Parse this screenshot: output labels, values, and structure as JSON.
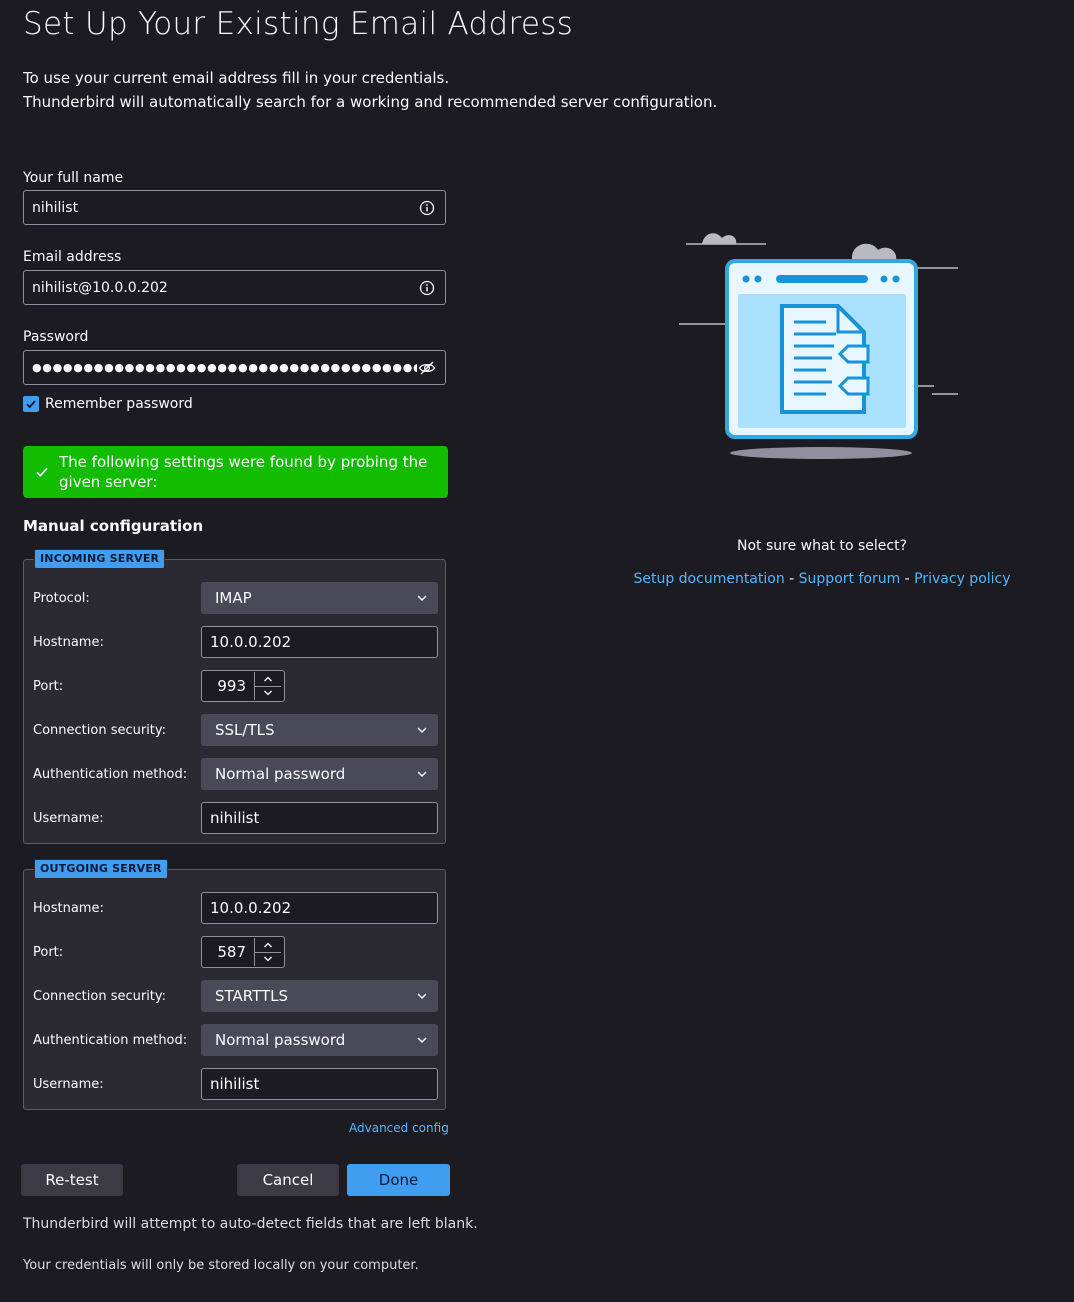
{
  "page": {
    "title": "Set Up Your Existing Email Address",
    "intro_line1": "To use your current email address fill in your credentials.",
    "intro_line2": "Thunderbird will automatically search for a working and recommended server configuration."
  },
  "form": {
    "name_label": "Your full name",
    "name_value": "nihilist",
    "email_label": "Email address",
    "email_value": "nihilist@10.0.0.202",
    "password_label": "Password",
    "password_mask": "●●●●●●●●●●●●●●●●●●●●●●●●●●●●●●●●●●●●●●●●●●",
    "remember_label": "Remember password",
    "remember_checked": true,
    "info_icon": "info-circle-icon",
    "hide_icon": "eye-slash-icon"
  },
  "notice": {
    "text": "The following settings were found by probing the given server:",
    "icon": "checkmark-icon",
    "color": "#12bc00"
  },
  "manual": {
    "title": "Manual configuration",
    "incoming": {
      "legend": "INCOMING SERVER",
      "protocol_label": "Protocol:",
      "protocol_value": "IMAP",
      "hostname_label": "Hostname:",
      "hostname_value": "10.0.0.202",
      "port_label": "Port:",
      "port_value": "993",
      "security_label": "Connection security:",
      "security_value": "SSL/TLS",
      "auth_label": "Authentication method:",
      "auth_value": "Normal password",
      "username_label": "Username:",
      "username_value": "nihilist"
    },
    "outgoing": {
      "legend": "OUTGOING SERVER",
      "hostname_label": "Hostname:",
      "hostname_value": "10.0.0.202",
      "port_label": "Port:",
      "port_value": "587",
      "security_label": "Connection security:",
      "security_value": "STARTTLS",
      "auth_label": "Authentication method:",
      "auth_value": "Normal password",
      "username_label": "Username:",
      "username_value": "nihilist"
    },
    "advanced_link": "Advanced config"
  },
  "buttons": {
    "retest": "Re-test",
    "cancel": "Cancel",
    "done": "Done"
  },
  "footer": {
    "autodetect": "Thunderbird will attempt to auto-detect fields that are left blank.",
    "credentials": "Your credentials will only be stored locally on your computer."
  },
  "help": {
    "question": "Not sure what to select?",
    "setup_doc": "Setup documentation",
    "support_forum": "Support forum",
    "privacy_policy": "Privacy policy",
    "separator": " - "
  },
  "colors": {
    "accent": "#3f9ef0",
    "background": "#1c1b22",
    "link": "#52b7ff"
  }
}
